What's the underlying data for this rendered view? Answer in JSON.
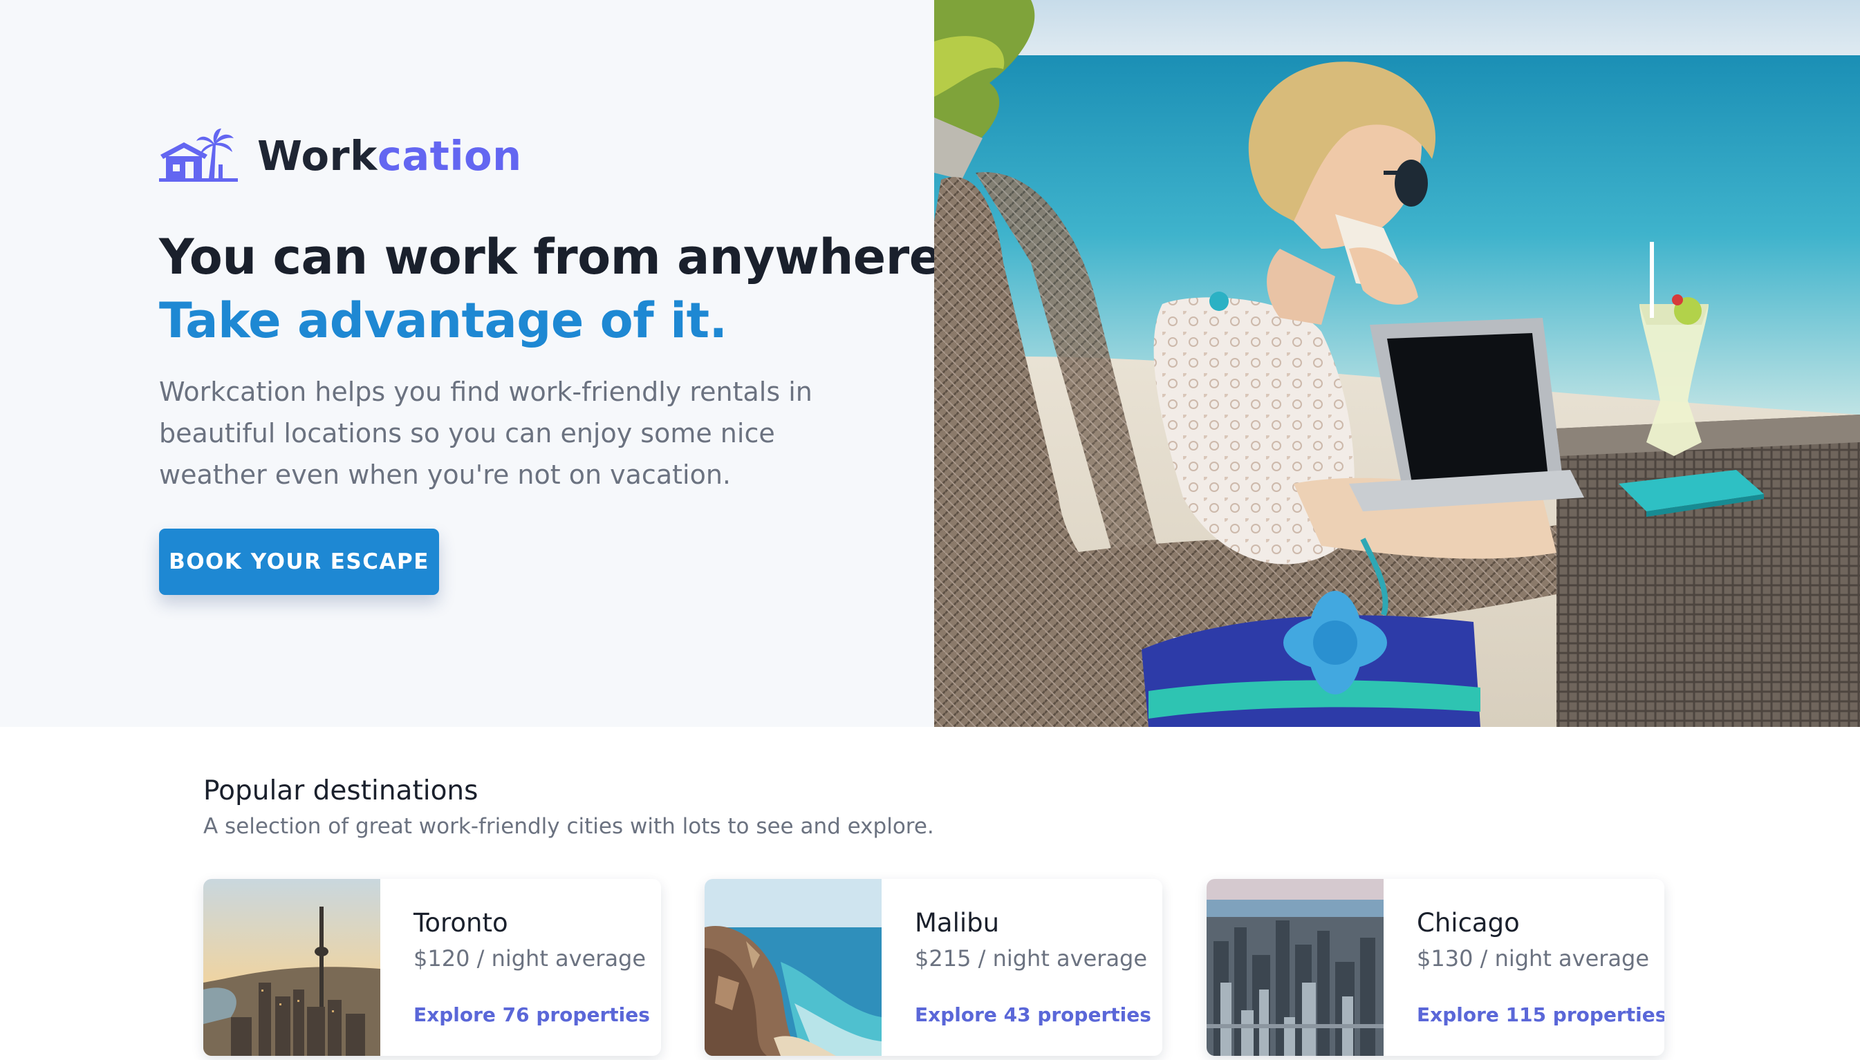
{
  "brand": {
    "name_part1": "Work",
    "name_part2": "cation",
    "icon": "beach-house-palm-icon",
    "color": "#6366f1"
  },
  "hero": {
    "headline_line1": "You can work from anywhere.",
    "headline_line2": "Take advantage of it.",
    "description": "Workcation helps you find work-friendly rentals in beautiful locations so you can enjoy some nice weather even when you're not on vacation.",
    "cta_label": "BOOK YOUR ESCAPE",
    "accent_color": "#1e88d3"
  },
  "destinations": {
    "title": "Popular destinations",
    "subtitle": "A selection of great work-friendly cities with lots to see and explore.",
    "items": [
      {
        "city": "Toronto",
        "price": "$120 / night average",
        "explore": "Explore 76 properties"
      },
      {
        "city": "Malibu",
        "price": "$215 / night average",
        "explore": "Explore 43 properties"
      },
      {
        "city": "Chicago",
        "price": "$130 / night average",
        "explore": "Explore 115 properties"
      }
    ]
  }
}
